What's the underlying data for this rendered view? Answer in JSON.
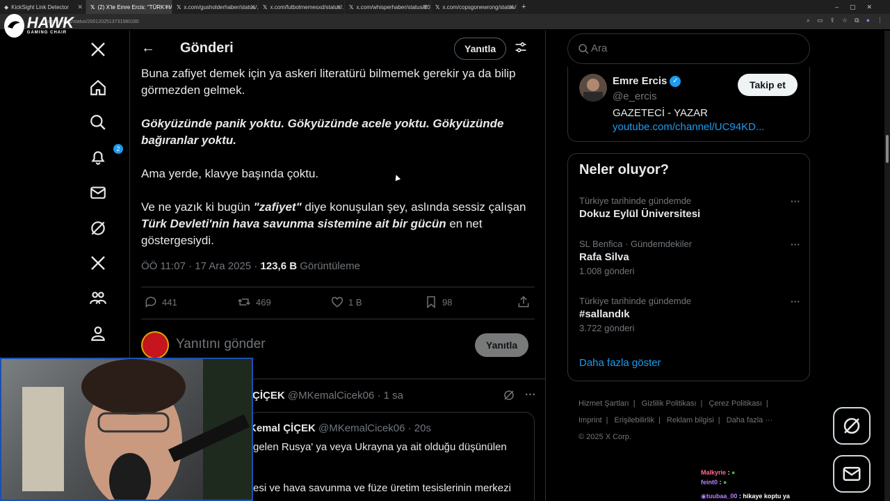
{
  "browser": {
    "tabs": [
      {
        "label": "KickSight Link Detector",
        "active": false
      },
      {
        "label": "(2) X'te Emre Ercis: \"TÜRK HAVA...",
        "active": true
      },
      {
        "label": "x.com/gusholderhaber/status/...",
        "active": false
      },
      {
        "label": "x.com/futbolmemesxd/status/...",
        "active": false
      },
      {
        "label": "x.com/whisperhaber/status/20...",
        "active": false
      },
      {
        "label": "x.com/copsgonewrong/status/...",
        "active": false
      }
    ],
    "url": "x.com/e_ercis/status/2001202513731580180"
  },
  "overlay_logo": {
    "brand": "HAWK",
    "subtitle": "GAMING CHAIR"
  },
  "sidebar": {
    "notifications_badge": "2"
  },
  "header": {
    "title": "Gönderi",
    "reply_label": "Yanıtla"
  },
  "tweet": {
    "p1": "Buna zafiyet demek için ya askeri literatürü bilmemek gerekir ya da bilip görmezden gelmek.",
    "p2": "Gökyüzünde panik yoktu. Gökyüzünde acele yoktu. Gökyüzünde bağıranlar yoktu.",
    "p3": "Ama yerde, klavye başında çoktu.",
    "p4_a": "Ve ne yazık ki bugün ",
    "p4_b": "\"zafiyet\"",
    "p4_c": " diye konuşulan şey, aslında sessiz çalışan ",
    "p4_d": "Türk Devleti'nin hava savunma sistemine ait bir gücün",
    "p4_e": " en net göstergesiydi.",
    "time": "ÖÖ 11:07 · 17 Ara 2025 · ",
    "views": "123,6 B",
    "views_label": " Görüntüleme",
    "replies": "441",
    "reposts": "469",
    "likes": "1 B",
    "bookmarks": "98"
  },
  "compose": {
    "placeholder": "Yanıtını gönder",
    "button": "Yanıtla"
  },
  "reply": {
    "name": "ÇİÇEK",
    "handle": "@MKemalCicek06",
    "time": "· 1 sa",
    "quote_name": "Kemal ÇİÇEK",
    "quote_handle": "@MKemalCicek06",
    "quote_time": "· 20s",
    "quote_text": "gelen Rusya' ya veya Ukrayna ya ait olduğu düşünülen",
    "quote_text2": "esi ve hava savunma ve füze üretim tesislerinin merkezi"
  },
  "search": {
    "placeholder": "Ara"
  },
  "profile": {
    "name": "Emre Ercis",
    "handle": "@e_ercis",
    "bio": "GAZETECİ - YAZAR",
    "link": "youtube.com/channel/UC94KD...",
    "follow_label": "Takip et"
  },
  "trends": {
    "title": "Neler oluyor?",
    "items": [
      {
        "category": "Türkiye tarihinde gündemde",
        "name": "Dokuz Eylül Üniversitesi",
        "count": ""
      },
      {
        "category": "SL Benfica · Gündemdekiler",
        "name": "Rafa Silva",
        "count": "1.008 gönderi"
      },
      {
        "category": "Türkiye tarihinde gündemde",
        "name": "#sallandık",
        "count": "3.722 gönderi"
      }
    ],
    "show_more": "Daha fazla göster"
  },
  "footer": {
    "links": [
      "Hizmet Şartları",
      "|",
      "Gizlilik Politikası",
      "|",
      "Çerez Politikası",
      "|",
      "Imprint",
      "|",
      "Erişilebilirlik",
      "|",
      "Reklam bilgisi",
      "|",
      "Daha fazla ···"
    ],
    "copyright": "© 2025 X Corp."
  },
  "chat": [
    {
      "user": "Malkyrie",
      "msg": ""
    },
    {
      "user": "feint0",
      "msg": ""
    },
    {
      "user": "tuubaa_00",
      "msg": "hikaye koptu ya"
    }
  ],
  "colors": {
    "accent": "#1d9bf0",
    "bg": "#000000",
    "border": "#2f3336",
    "muted": "#71767b"
  }
}
